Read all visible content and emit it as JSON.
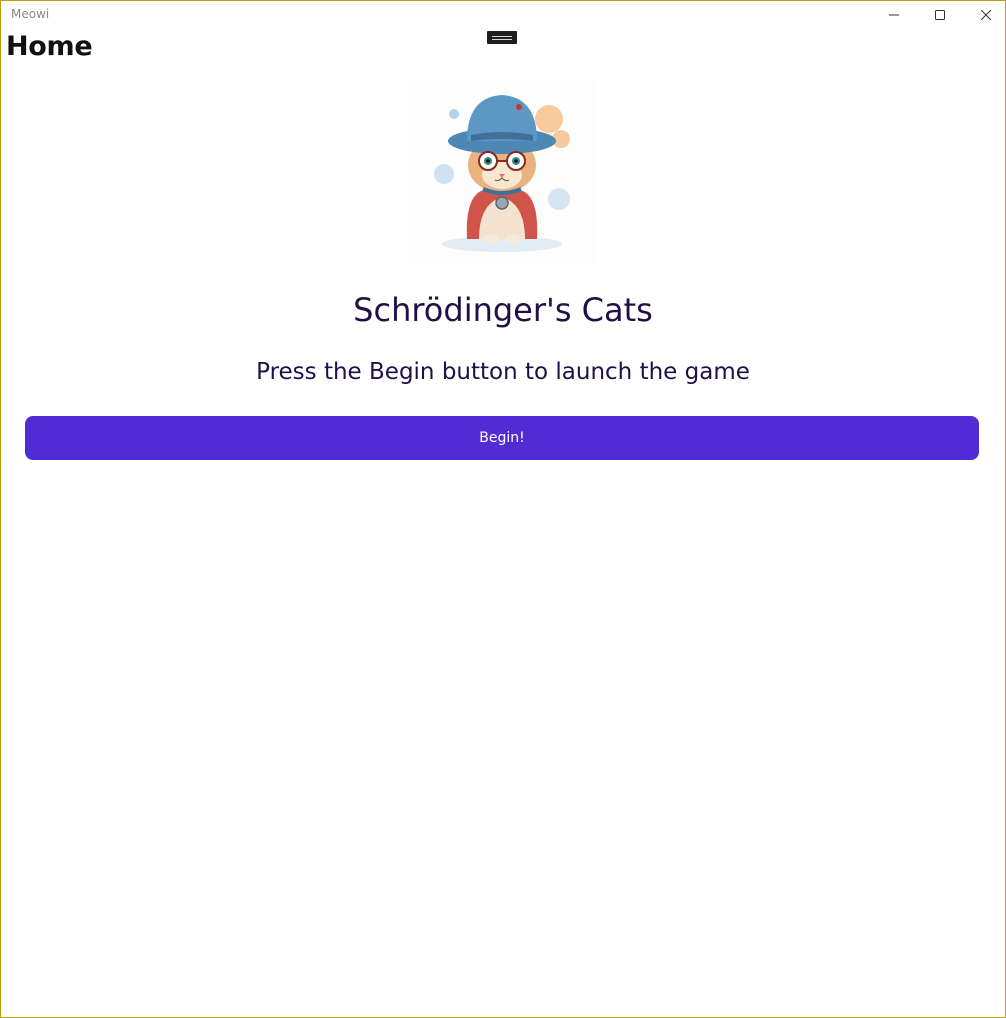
{
  "window": {
    "app_title": "Meowi",
    "controls": {
      "minimize": "minimize-icon",
      "maximize": "maximize-icon",
      "close": "close-icon"
    }
  },
  "page": {
    "title": "Home"
  },
  "hero": {
    "image": "cat-with-hat-and-glasses-illustration"
  },
  "content": {
    "game_title": "Schrödinger's Cats",
    "instructions": "Press the Begin button to launch the game",
    "begin_label": "Begin!"
  },
  "colors": {
    "accent": "#512bd4",
    "heading_text": "#1f1148",
    "window_border": "#b8a200"
  }
}
